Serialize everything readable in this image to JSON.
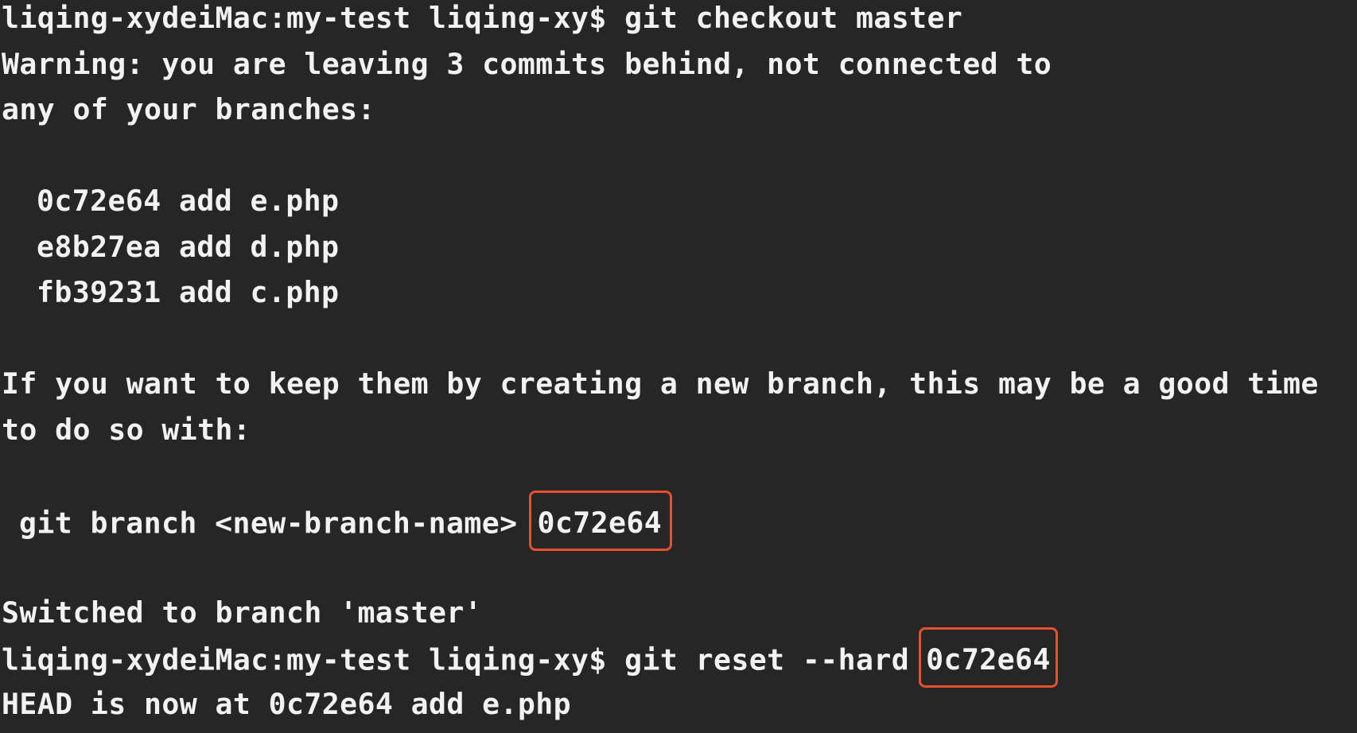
{
  "terminal": {
    "lines": {
      "l1": "liqing-xydeiMac:my-test liqing-xy$ git checkout master",
      "l2": "Warning: you are leaving 3 commits behind, not connected to",
      "l3": "any of your branches:",
      "c1": "0c72e64 add e.php",
      "c2": "e8b27ea add d.php",
      "c3": "fb39231 add c.php",
      "l7": "If you want to keep them by creating a new branch, this may be a good time",
      "l8": "to do so with:",
      "branch_cmd": "git branch <new-branch-name>",
      "branch_hash": "0c72e64",
      "l10": "Switched to branch 'master'",
      "reset_cmd": "liqing-xydeiMac:my-test liqing-xy$ git reset --hard",
      "reset_hash": "0c72e64",
      "l12": "HEAD is now at 0c72e64 add e.php"
    },
    "colors": {
      "background": "#262626",
      "text": "#f2f2f2",
      "highlight_border": "#e5502f"
    }
  }
}
